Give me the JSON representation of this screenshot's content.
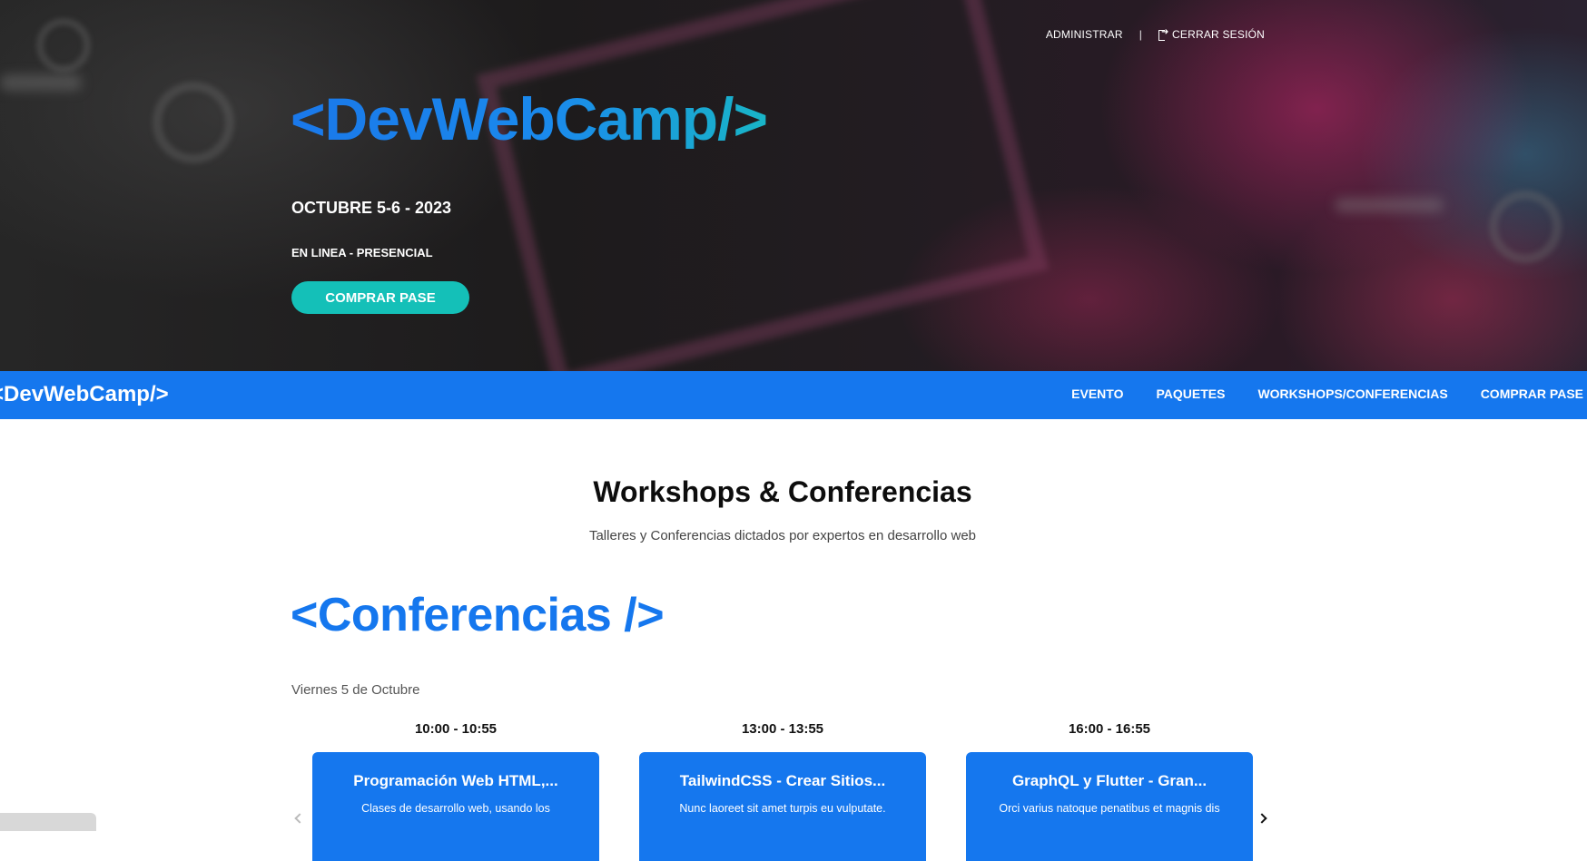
{
  "header": {
    "admin_link": "ADMINISTRAR",
    "separator": "|",
    "logout_link": "CERRAR SESIÓN",
    "logo": "<DevWebCamp/>",
    "date": "OCTUBRE 5-6 - 2023",
    "mode": "EN LINEA - PRESENCIAL",
    "buy_button": "COMPRAR PASE"
  },
  "navbar": {
    "logo": "<DevWebCamp/>",
    "links": [
      "EVENTO",
      "PAQUETES",
      "WORKSHOPS/CONFERENCIAS",
      "COMPRAR PASE"
    ]
  },
  "main": {
    "title": "Workshops & Conferencias",
    "subtitle": "Talleres y Conferencias dictados por expertos en desarrollo web",
    "section_heading": "<Conferencias />",
    "day": "Viernes 5 de Octubre",
    "slots": [
      {
        "time": "10:00 - 10:55",
        "title": "Programación Web HTML,...",
        "desc": "Clases de desarrollo web, usando los"
      },
      {
        "time": "13:00 - 13:55",
        "title": "TailwindCSS - Crear Sitios...",
        "desc": "Nunc laoreet sit amet turpis eu vulputate."
      },
      {
        "time": "16:00 - 16:55",
        "title": "GraphQL y Flutter - Gran...",
        "desc": "Orci varius natoque penatibus et magnis dis"
      }
    ]
  },
  "colors": {
    "primary_blue": "#1577ee",
    "teal_button": "#14c0b8"
  }
}
